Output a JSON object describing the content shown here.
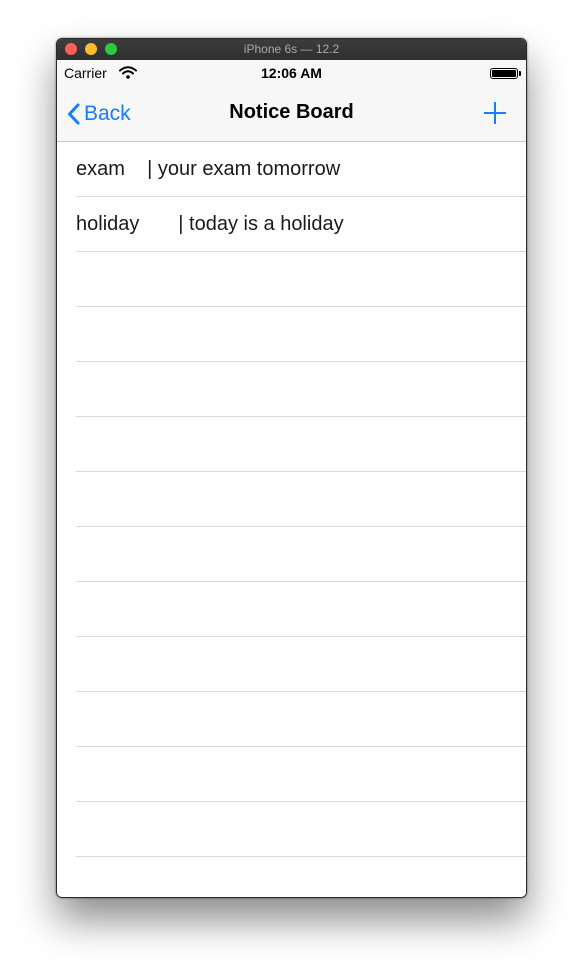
{
  "window": {
    "title": "iPhone 6s — 12.2"
  },
  "status_bar": {
    "carrier": "Carrier",
    "time": "12:06 AM"
  },
  "nav": {
    "back_label": "Back",
    "title": "Notice Board",
    "add_icon": "plus-icon",
    "accent_color": "#147efb"
  },
  "notices": [
    {
      "text": "exam    | your exam tomorrow"
    },
    {
      "text": "holiday       | today is a holiday"
    }
  ]
}
